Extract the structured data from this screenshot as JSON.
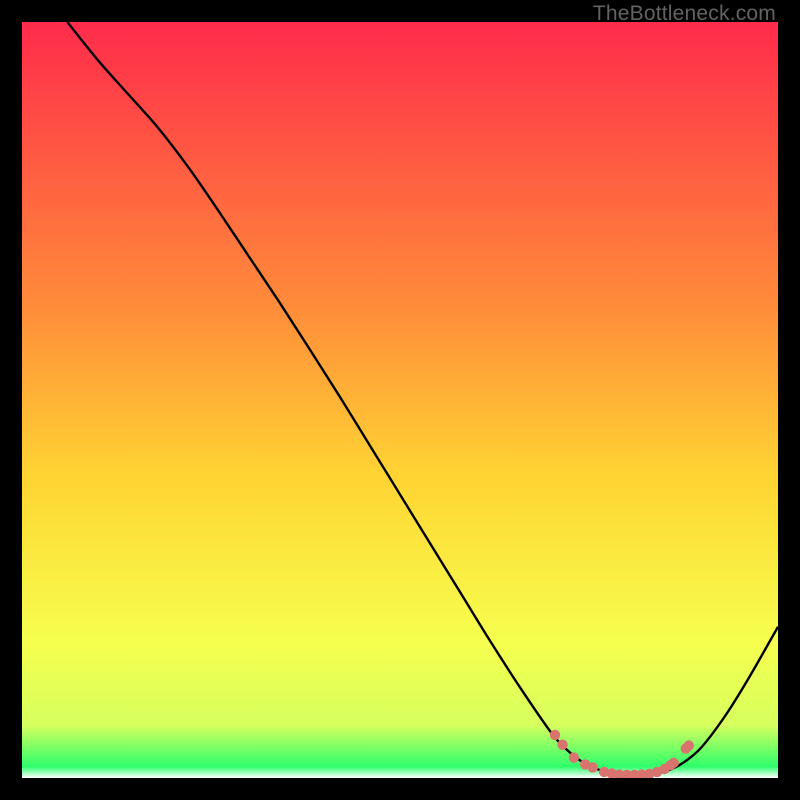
{
  "watermark": "TheBottleneck.com",
  "chart_data": {
    "type": "line",
    "title": "",
    "xlabel": "",
    "ylabel": "",
    "xlim": [
      0,
      100
    ],
    "ylim": [
      0,
      100
    ],
    "grid": false,
    "legend": false,
    "background_gradient": {
      "stops": [
        {
          "offset": 0.0,
          "color": "#ff2b4b"
        },
        {
          "offset": 0.38,
          "color": "#ff8d3a"
        },
        {
          "offset": 0.6,
          "color": "#ffd433"
        },
        {
          "offset": 0.82,
          "color": "#f6ff4e"
        },
        {
          "offset": 0.93,
          "color": "#d6ff5e"
        },
        {
          "offset": 0.985,
          "color": "#2eff6c"
        },
        {
          "offset": 1.0,
          "color": "#ffffff"
        }
      ]
    },
    "series": [
      {
        "name": "bottleneck-curve",
        "x": [
          6,
          10,
          14,
          18,
          22,
          26,
          30,
          34,
          38,
          42,
          46,
          50,
          54,
          58,
          62,
          66,
          70,
          72,
          74,
          76,
          78,
          80,
          82,
          84,
          86,
          88,
          90,
          93,
          96,
          100
        ],
        "y": [
          100,
          95,
          90.5,
          86,
          80.8,
          75,
          69,
          63,
          56.8,
          50.5,
          44,
          37.5,
          31,
          24.5,
          18,
          11.8,
          6,
          3.8,
          2.2,
          1.2,
          0.6,
          0.4,
          0.4,
          0.6,
          1.2,
          2.4,
          4.2,
          8.2,
          13,
          20
        ]
      }
    ],
    "highlight_points": {
      "name": "trough-markers",
      "color": "#d8736e",
      "x": [
        70.5,
        71.5,
        73,
        74.5,
        75.5,
        77,
        78,
        79,
        80,
        81,
        82,
        83,
        84,
        85,
        85.8,
        86.2,
        87.8,
        88.2
      ],
      "y": [
        5.7,
        4.4,
        2.7,
        1.8,
        1.4,
        0.8,
        0.6,
        0.45,
        0.4,
        0.4,
        0.45,
        0.55,
        0.8,
        1.2,
        1.7,
        2.0,
        3.9,
        4.3
      ]
    }
  }
}
